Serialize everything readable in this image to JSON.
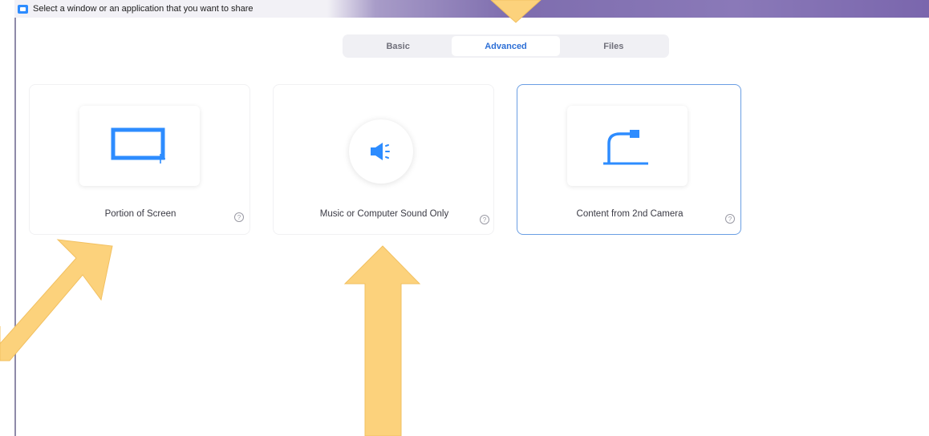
{
  "window": {
    "title": "Select a window or an application that you want to share"
  },
  "tabs": [
    {
      "label": "Basic",
      "active": false
    },
    {
      "label": "Advanced",
      "active": true
    },
    {
      "label": "Files",
      "active": false
    }
  ],
  "options": [
    {
      "label": "Portion of Screen",
      "icon": "portion-of-screen-icon",
      "help": "?"
    },
    {
      "label": "Music or Computer Sound Only",
      "icon": "speaker-icon",
      "help": "?"
    },
    {
      "label": "Content from 2nd Camera",
      "icon": "document-camera-icon",
      "help": "?",
      "selected": true
    }
  ],
  "colors": {
    "accent": "#2d8cff",
    "selected_border": "#6a9ee3",
    "annotation_arrow": "#fcd27c"
  }
}
